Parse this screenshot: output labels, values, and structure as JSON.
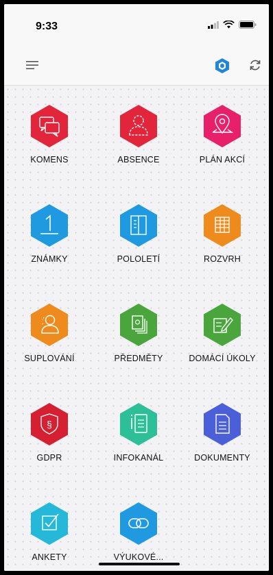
{
  "status": {
    "time": "9:33"
  },
  "toolbar": {
    "menu_icon": "hamburger-menu-icon",
    "logo_icon": "app-logo-icon",
    "refresh_icon": "refresh-icon"
  },
  "colors": {
    "red": "#e0213a",
    "pink": "#e8206a",
    "blue": "#1f9ae0",
    "orange": "#ef8a1c",
    "green": "#4aa53c",
    "teal": "#2dbf97",
    "indigo": "#4b5fd8",
    "cyan": "#25b8d8",
    "dark_red": "#d62032",
    "logo": "#2186d6"
  },
  "tiles": [
    {
      "label": "KOMENS",
      "icon": "chat-bubbles-icon",
      "color": "#e2253b"
    },
    {
      "label": "ABSENCE",
      "icon": "person-dashed-icon",
      "color": "#e2253b"
    },
    {
      "label": "PLÁN AKCÍ",
      "icon": "map-pin-icon",
      "color": "#e8206a"
    },
    {
      "label": "ZNÁMKY",
      "icon": "grade-one-icon",
      "color": "#1f9ae0"
    },
    {
      "label": "POLOLETÍ",
      "icon": "open-book-icon",
      "color": "#1f9ae0"
    },
    {
      "label": "ROZVRH",
      "icon": "timetable-icon",
      "color": "#ef8a1c"
    },
    {
      "label": "SUPLOVÁNÍ",
      "icon": "substitute-person-icon",
      "color": "#ef8a1c"
    },
    {
      "label": "PŘEDMĚTY",
      "icon": "subjects-icon",
      "color": "#4aa53c"
    },
    {
      "label": "DOMÁCÍ ÚKOLY",
      "icon": "homework-pencil-icon",
      "color": "#4aa53c"
    },
    {
      "label": "GDPR",
      "icon": "gdpr-shield-icon",
      "color": "#d62032"
    },
    {
      "label": "INFOKANÁL",
      "icon": "info-list-icon",
      "color": "#2dbf97"
    },
    {
      "label": "DOKUMENTY",
      "icon": "document-icon",
      "color": "#4b5fd8"
    },
    {
      "label": "ANKETY",
      "icon": "poll-checkbox-icon",
      "color": "#25b8d8"
    },
    {
      "label": "VÝUKOVÉ...",
      "icon": "link-icon",
      "color": "#1f9ae0"
    }
  ]
}
